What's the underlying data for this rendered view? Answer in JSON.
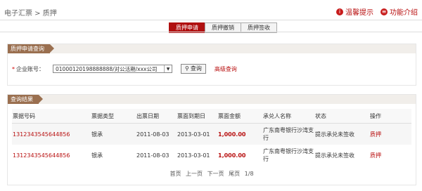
{
  "header": {
    "breadcrumb": "电子汇票 > 质押",
    "tips_label": "温馨提示",
    "intro_label": "功能介绍"
  },
  "tabs": [
    {
      "label": "质押申请"
    },
    {
      "label": "质押撤销"
    },
    {
      "label": "质押签收"
    }
  ],
  "query": {
    "section_title": "质押申请查询",
    "required_mark": "*",
    "account_label": "企业账号：",
    "account_value": "01000120198888888/对公活期/xxx公司",
    "search_button": "查询",
    "advanced_label": "高级查询"
  },
  "results": {
    "section_title": "查询结果",
    "columns": [
      "票据号码",
      "票据类型",
      "出票日期",
      "票面到期日",
      "票面金额",
      "承兑人名称",
      "状态",
      "操作"
    ],
    "rows": [
      [
        "1312343545644856",
        "银承",
        "2011-08-03",
        "2013-03-01",
        "1,000.00",
        "广东南粤银行沙湾支行",
        "提示承兑未签收",
        "质押"
      ],
      [
        "1312343545644856",
        "银承",
        "2011-08-03",
        "2013-03-01",
        "1,000.00",
        "广东南粤银行沙湾支行",
        "提示承兑未签收",
        "质押"
      ]
    ]
  },
  "pager": {
    "first": "首页",
    "prev": "上一页",
    "next": "下一页",
    "last": "尾页",
    "info": "1/8"
  },
  "colors": {
    "accent": "#b80f0f",
    "tag_brown": "#9a6f4f"
  }
}
